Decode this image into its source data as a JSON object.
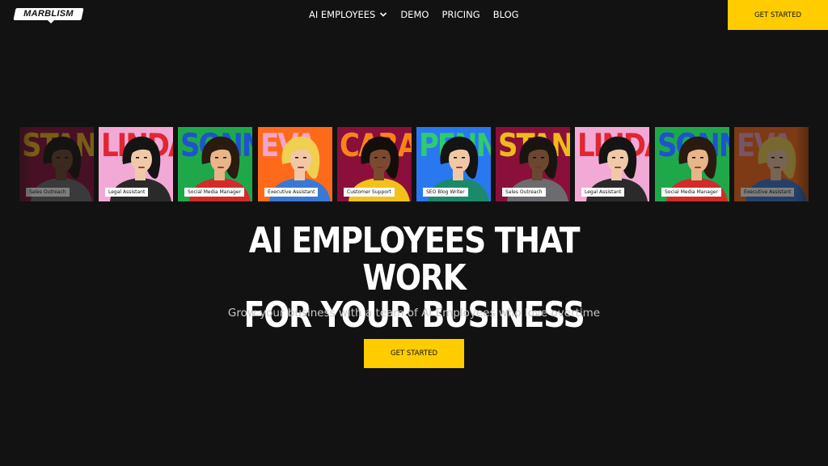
{
  "brand": {
    "logo_text": "MARBLISM"
  },
  "nav": {
    "items": [
      {
        "label": "AI EMPLOYEES",
        "has_dropdown": true,
        "icon": "chevron-down-icon"
      },
      {
        "label": "DEMO"
      },
      {
        "label": "PRICING"
      },
      {
        "label": "BLOG"
      }
    ],
    "cta_label": "GET STARTED"
  },
  "employees": [
    {
      "name": "STAN",
      "role": "Sales Outreach",
      "bg": "#8a0f3a",
      "name_color": "#f5c518",
      "skin": "#6b4630",
      "hair": "#1a1410",
      "shirt": "#6b6b70",
      "dimmed": true
    },
    {
      "name": "LINDA",
      "role": "Legal Assistant",
      "bg": "#f2a9d6",
      "name_color": "#e0202a",
      "skin": "#f0c9a8",
      "hair": "#141414",
      "shirt": "#2a2a2a",
      "dimmed": false
    },
    {
      "name": "SONNY",
      "role": "Social Media Manager",
      "bg": "#1fa84a",
      "name_color": "#1e4fd8",
      "skin": "#e8b48a",
      "hair": "#2a1a10",
      "shirt": "#d42a2a",
      "dimmed": false
    },
    {
      "name": "EVA",
      "role": "Executive Assistant",
      "bg": "#ff6a1a",
      "name_color": "#f2a9d6",
      "skin": "#f2c8a4",
      "hair": "#f0d050",
      "shirt": "#3a78d6",
      "dimmed": false
    },
    {
      "name": "CARA",
      "role": "Customer Support",
      "bg": "#8a0f3a",
      "name_color": "#ff8a1a",
      "skin": "#7a4a30",
      "hair": "#140e0a",
      "shirt": "#f2c21a",
      "dimmed": false
    },
    {
      "name": "PENNY",
      "role": "SEO Blog Writer",
      "bg": "#2a78f0",
      "name_color": "#2fd06a",
      "skin": "#f0c8a6",
      "hair": "#141414",
      "shirt": "#1a8a6a",
      "dimmed": false
    },
    {
      "name": "STAN",
      "role": "Sales Outreach",
      "bg": "#8a0f3a",
      "name_color": "#f5c518",
      "skin": "#6b4630",
      "hair": "#1a1410",
      "shirt": "#6b6b70",
      "dimmed": false
    },
    {
      "name": "LINDA",
      "role": "Legal Assistant",
      "bg": "#f2a9d6",
      "name_color": "#e0202a",
      "skin": "#f0c9a8",
      "hair": "#141414",
      "shirt": "#2a2a2a",
      "dimmed": false
    },
    {
      "name": "SONNY",
      "role": "Social Media Manager",
      "bg": "#1fa84a",
      "name_color": "#1e4fd8",
      "skin": "#e8b48a",
      "hair": "#2a1a10",
      "shirt": "#d42a2a",
      "dimmed": false
    },
    {
      "name": "EVA",
      "role": "Executive Assistant",
      "bg": "#ff6a1a",
      "name_color": "#f2a9d6",
      "skin": "#f2c8a4",
      "hair": "#f0d050",
      "shirt": "#3a78d6",
      "dimmed": true
    }
  ],
  "hero": {
    "headline_line1": "AI EMPLOYEES THAT WORK",
    "headline_line2": "FOR YOUR BUSINESS",
    "subtitle": "Grow your business with a team of AI Employees who love overtime",
    "cta_label": "GET STARTED"
  },
  "colors": {
    "background": "#121212",
    "accent": "#ffcc00",
    "text": "#ffffff",
    "muted": "#c9c9c9"
  }
}
